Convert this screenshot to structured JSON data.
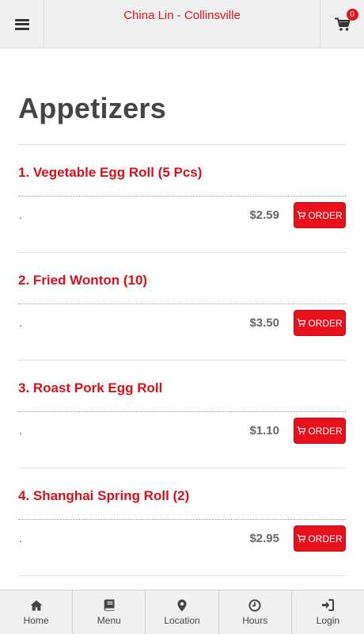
{
  "header": {
    "title": "China Lin - Collinsville",
    "cart_count": "0"
  },
  "section": {
    "title": "Appetizers"
  },
  "items": [
    {
      "name": "1. Vegetable Egg Roll (5 Pcs)",
      "description": ".",
      "price": "$2.59",
      "order_label": "ORDER"
    },
    {
      "name": "2. Fried Wonton (10)",
      "description": ".",
      "price": "$3.50",
      "order_label": "ORDER"
    },
    {
      "name": "3. Roast Pork Egg Roll",
      "description": ".",
      "price": "$1.10",
      "order_label": "ORDER"
    },
    {
      "name": "4. Shanghai Spring Roll (2)",
      "description": ".",
      "price": "$2.95",
      "order_label": "ORDER"
    }
  ],
  "nav": {
    "items": [
      {
        "label": "Home",
        "icon": "home-icon"
      },
      {
        "label": "Menu",
        "icon": "book-icon"
      },
      {
        "label": "Location",
        "icon": "map-marker-icon"
      },
      {
        "label": "Hours",
        "icon": "clock-icon"
      },
      {
        "label": "Login",
        "icon": "sign-in-icon"
      }
    ]
  },
  "colors": {
    "brand_red": "#e0141e",
    "header_bg": "#f0f0f0",
    "heading_gray": "#444444"
  }
}
